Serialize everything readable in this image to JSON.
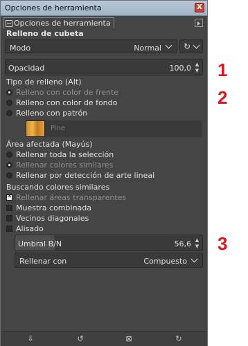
{
  "window": {
    "title": "Opciones de herramienta",
    "close_symbol": "X"
  },
  "tab": {
    "label": "Opciones de herramienta"
  },
  "tool": {
    "name": "Relleno de cubeta"
  },
  "mode": {
    "label": "Modo",
    "value": "Normal"
  },
  "opacity": {
    "label": "Opacidad",
    "value": "100,0"
  },
  "fill_type": {
    "label": "Tipo de relleno  (Alt)",
    "options": [
      {
        "label": "Relleno con color de frente",
        "selected": true,
        "disabled": true
      },
      {
        "label": "Relleno con color de fondo",
        "selected": false,
        "disabled": false
      },
      {
        "label": "Relleno con patrón",
        "selected": false,
        "disabled": false
      }
    ],
    "pattern_name": "Pine"
  },
  "affected_area": {
    "label": "Área afectada  (Mayús)",
    "options": [
      {
        "label": "Rellenar toda la selección",
        "selected": false,
        "disabled": false
      },
      {
        "label": "Rellenar colores similares",
        "selected": true,
        "disabled": true
      },
      {
        "label": "Rellenar por detección de arte lineal",
        "selected": false,
        "disabled": false
      }
    ]
  },
  "similar": {
    "label": "Buscando colores similares",
    "options": [
      {
        "label": "Rellenar áreas transparentes",
        "checked": true,
        "disabled": true
      },
      {
        "label": "Muestra combinada",
        "checked": false,
        "disabled": false
      },
      {
        "label": "Vecinos diagonales",
        "checked": false,
        "disabled": false
      },
      {
        "label": "Alisado",
        "checked": false,
        "disabled": false
      }
    ]
  },
  "threshold": {
    "label": "Umbral B/N",
    "value": "56,6"
  },
  "fill_by": {
    "label": "Rellenar con",
    "value": "Compuesto"
  },
  "annotations": [
    "1",
    "2",
    "3"
  ],
  "colors": {
    "panel": "#454545",
    "annotation": "#d71920",
    "titlebar": "#b9c9d8"
  }
}
